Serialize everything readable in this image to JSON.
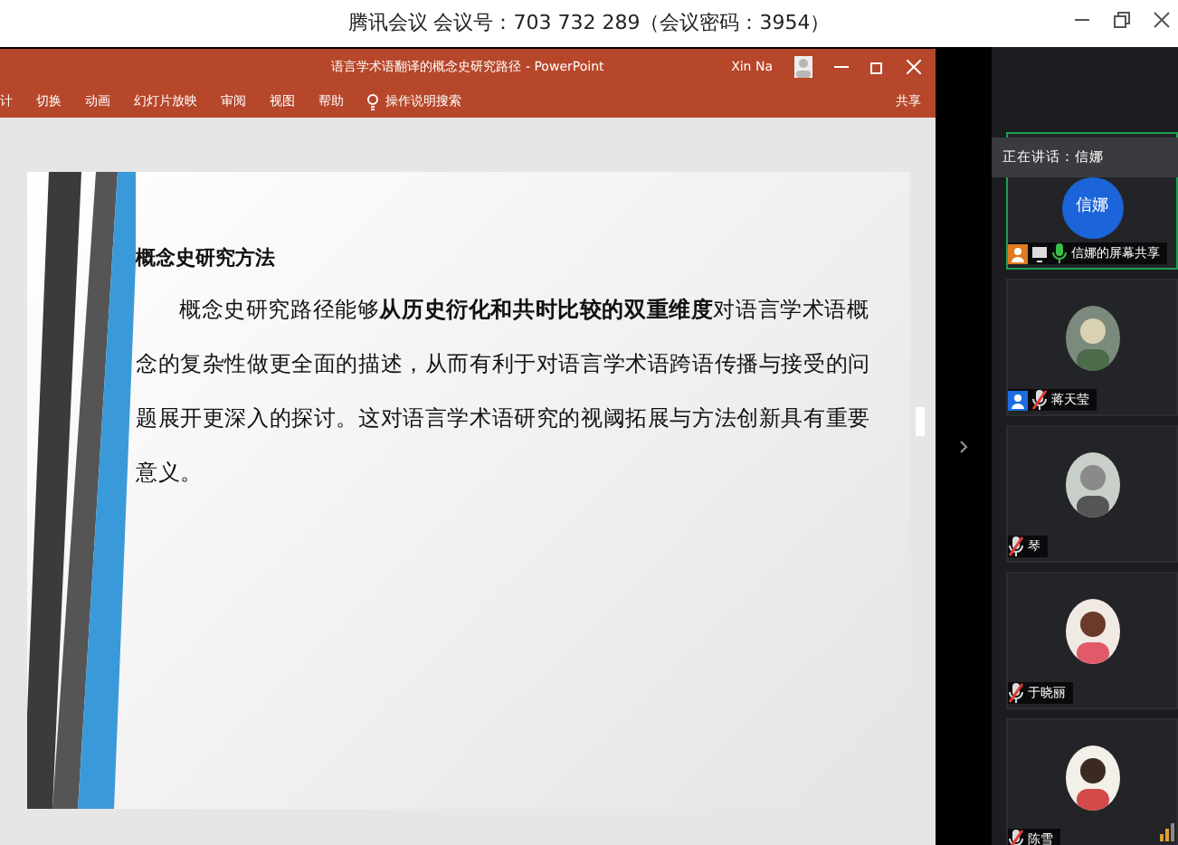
{
  "meeting_bar": {
    "title": "腾讯会议 会议号：703 732 289（会议密码：3954）"
  },
  "powerpoint": {
    "title": "语言学术语翻译的概念史研究路径 - PowerPoint",
    "user": "Xin Na",
    "ribbon_tabs": [
      "计",
      "切换",
      "动画",
      "幻灯片放映",
      "审阅",
      "视图",
      "帮助"
    ],
    "search_hint": "操作说明搜索",
    "share": "共享"
  },
  "slide": {
    "heading": "概念史研究方法",
    "paragraph": "概念史研究路径能够**从历史衍化和共时比较的双重维度**对语言学术语概念的复杂性做更全面的描述，从而有利于对语言学术语跨语传播与接受的问题展开更深入的探讨。这对语言学术语研究的视阈拓展与方法创新具有重要意义。"
  },
  "participants": {
    "speaking": "正在讲话：信娜",
    "tiles": [
      {
        "kind": "initials",
        "avatar_text": "信娜",
        "name": "信娜的屏幕共享",
        "host": true,
        "cohost": false,
        "sharing": true,
        "muted": false,
        "selected": true
      },
      {
        "kind": "picture",
        "name": "蒋天莹",
        "host": false,
        "cohost": true,
        "sharing": false,
        "muted": true,
        "selected": false
      },
      {
        "kind": "picture",
        "name": "琴",
        "host": false,
        "cohost": false,
        "sharing": false,
        "muted": true,
        "selected": false
      },
      {
        "kind": "picture",
        "name": "于晓丽",
        "host": false,
        "cohost": false,
        "sharing": false,
        "muted": true,
        "selected": false
      },
      {
        "kind": "picture",
        "name": "陈雪",
        "host": false,
        "cohost": false,
        "sharing": false,
        "muted": true,
        "selected": false
      }
    ]
  }
}
